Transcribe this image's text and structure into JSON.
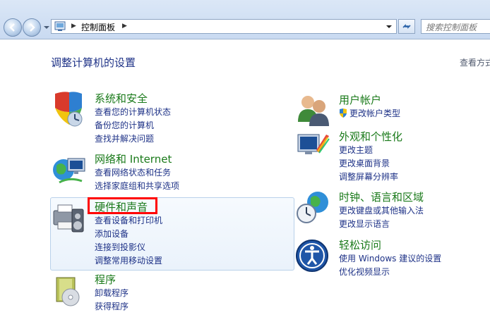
{
  "nav": {
    "breadcrumb": "控制面板",
    "search_placeholder": "搜索控制面板"
  },
  "content": {
    "title": "调整计算机的设置",
    "view_by": "查看方式"
  },
  "categories": {
    "system": {
      "title": "系统和安全",
      "links": [
        "查看您的计算机状态",
        "备份您的计算机",
        "查找并解决问题"
      ]
    },
    "network": {
      "title": "网络和 Internet",
      "links": [
        "查看网络状态和任务",
        "选择家庭组和共享选项"
      ]
    },
    "hardware": {
      "title": "硬件和声音",
      "links": [
        "查看设备和打印机",
        "添加设备",
        "连接到投影仪",
        "调整常用移动设置"
      ]
    },
    "programs": {
      "title": "程序",
      "links": [
        "卸载程序",
        "获得程序"
      ]
    },
    "users": {
      "title": "用户帐户",
      "links": [
        "更改帐户类型"
      ]
    },
    "appearance": {
      "title": "外观和个性化",
      "links": [
        "更改主题",
        "更改桌面背景",
        "调整屏幕分辨率"
      ]
    },
    "clock": {
      "title": "时钟、语言和区域",
      "links": [
        "更改键盘或其他输入法",
        "更改显示语言"
      ]
    },
    "ease": {
      "title": "轻松访问",
      "links": [
        "使用 Windows 建议的设置",
        "优化视频显示"
      ]
    }
  },
  "colors": {
    "category_title": "#1a7a1a",
    "link": "#1e3287",
    "highlight": "#ff0000"
  }
}
